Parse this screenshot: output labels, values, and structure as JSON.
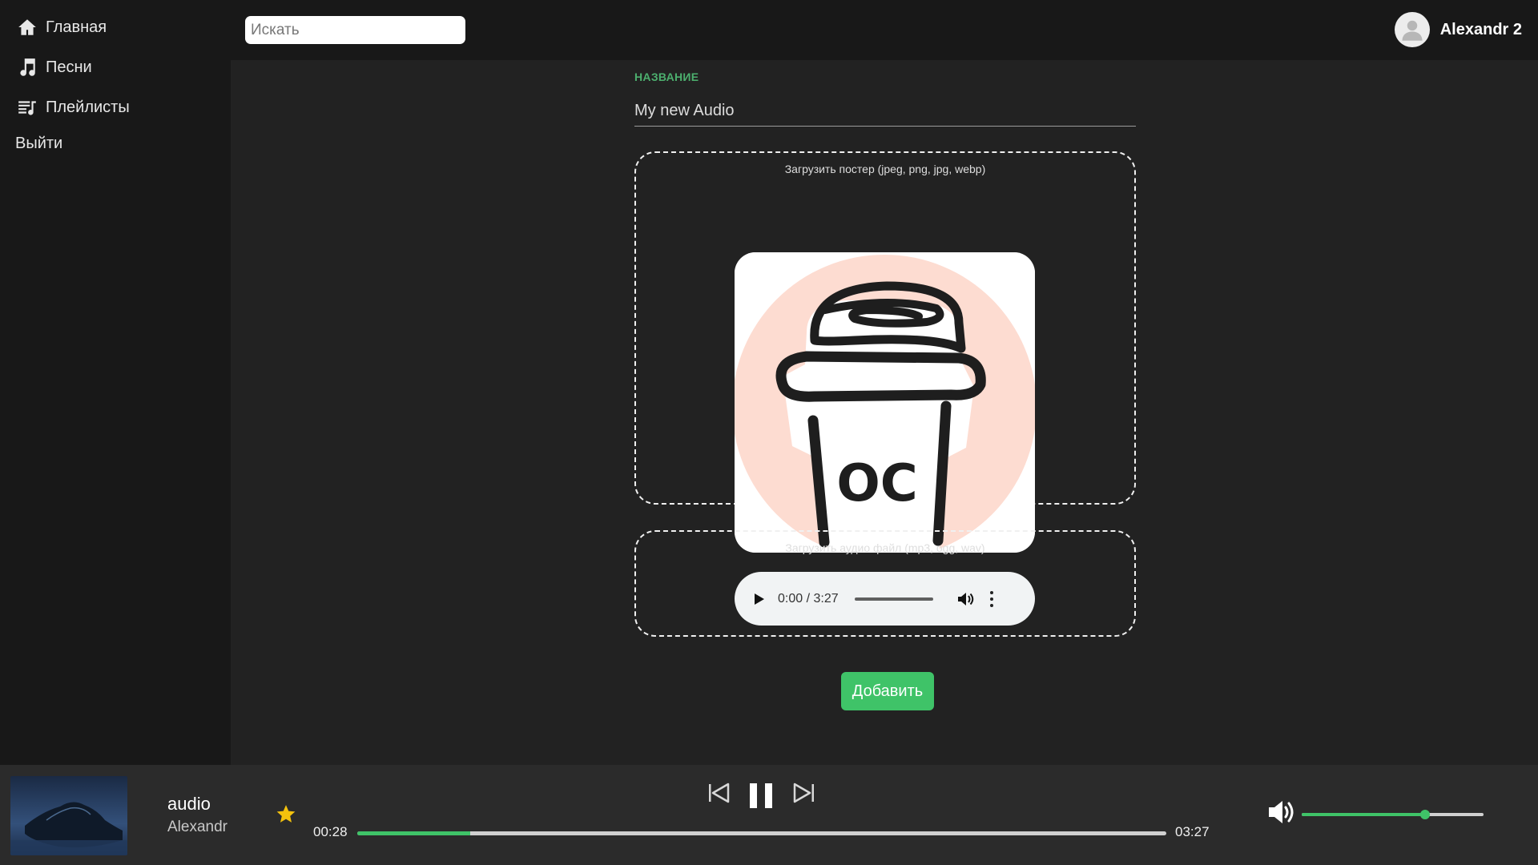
{
  "sidebar": {
    "items": [
      {
        "label": "Главная",
        "icon": "home-icon"
      },
      {
        "label": "Песни",
        "icon": "music-note-icon"
      },
      {
        "label": "Плейлисты",
        "icon": "playlist-icon"
      }
    ],
    "logout_label": "Выйти"
  },
  "header": {
    "search_placeholder": "Искать",
    "search_value": "",
    "username": "Alexandr 2",
    "avatar_icon": "user-avatar-icon"
  },
  "form": {
    "title_label": "НАЗВАНИЕ",
    "title_value": "My new Audio",
    "poster_caption": "Загрузить постер (jpeg, png, jpg, webp)",
    "poster_logo_text": "OC",
    "audio_caption": "Загрузить аудио файл (mp3, ogg, wav)",
    "audio_time": "0:00 / 3:27",
    "submit_label": "Добавить"
  },
  "player": {
    "track_title": "audio",
    "track_artist": "Alexandr",
    "current_time": "00:28",
    "total_time": "03:27",
    "progress_percent": 14,
    "volume_percent": 68,
    "favorite": true,
    "state": "playing",
    "icons": [
      "prev-icon",
      "pause-icon",
      "next-icon",
      "volume-icon",
      "star-icon"
    ]
  },
  "colors": {
    "accent": "#3fc368",
    "background": "#222222",
    "sidebar": "#181818",
    "player": "#2b2b2b",
    "star": "#f4c20d"
  }
}
